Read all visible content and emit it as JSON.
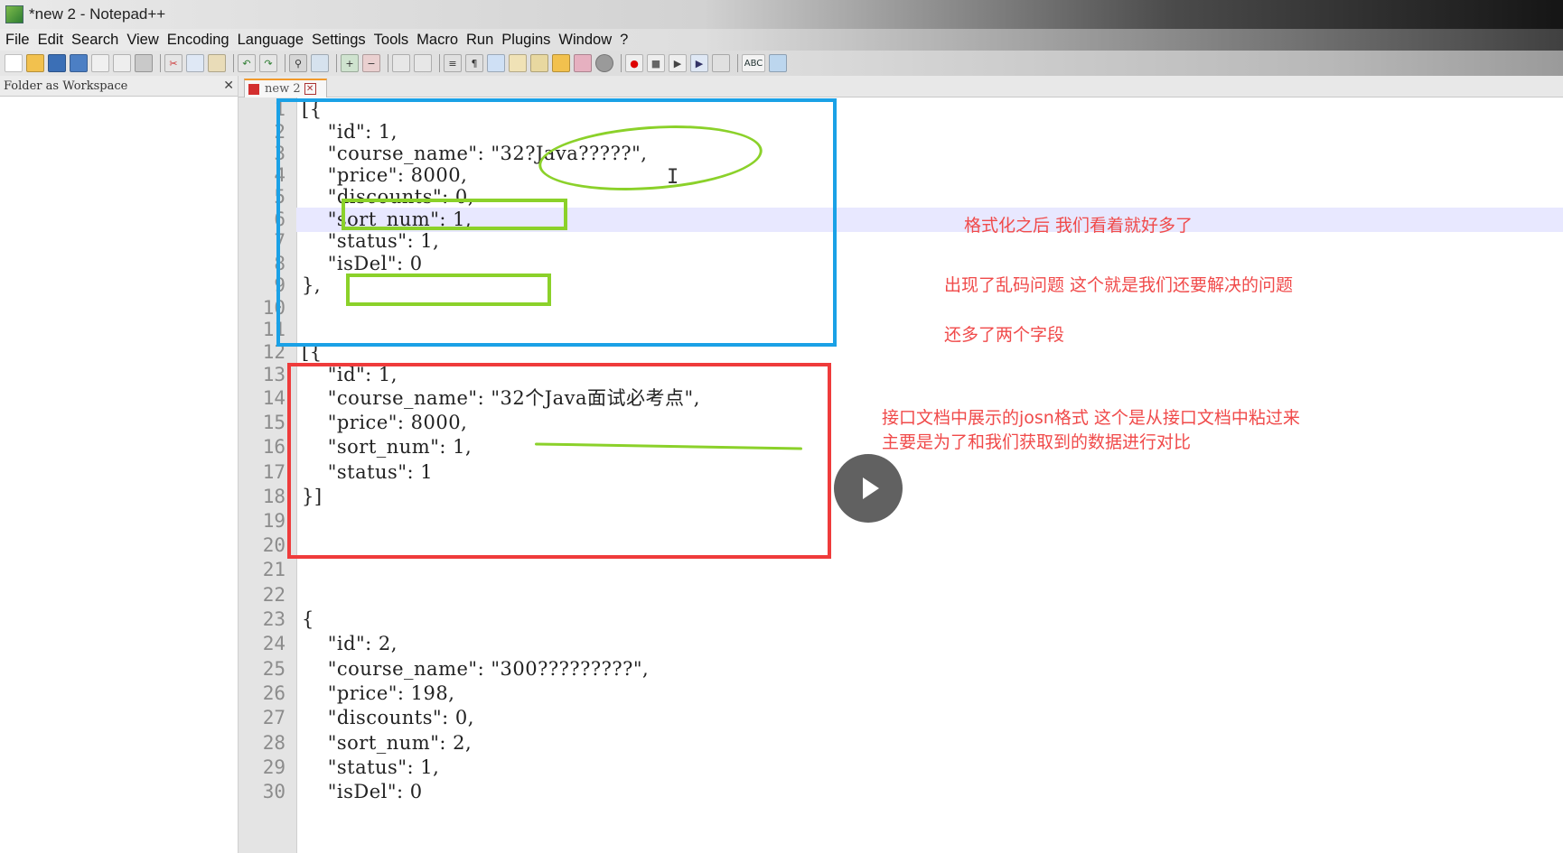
{
  "window": {
    "title": "*new 2 - Notepad++"
  },
  "menu": [
    "File",
    "Edit",
    "Search",
    "View",
    "Encoding",
    "Language",
    "Settings",
    "Tools",
    "Macro",
    "Run",
    "Plugins",
    "Window",
    "?"
  ],
  "toolbar": {
    "icons": [
      "new-file-icon",
      "open-file-icon",
      "save-icon",
      "save-all-icon",
      "close-icon",
      "close-all-icon",
      "print-icon",
      "cut-icon",
      "copy-icon",
      "paste-icon",
      "undo-icon",
      "redo-icon",
      "find-icon",
      "replace-icon",
      "zoom-in-icon",
      "zoom-out-icon",
      "sync-vertical-icon",
      "sync-horizontal-icon",
      "word-wrap-icon",
      "show-all-chars-icon",
      "indent-guide-icon",
      "doc-map-icon",
      "function-list-icon",
      "folder-workspace-icon",
      "monitor-icon",
      "macro-record-icon",
      "macro-stop-icon",
      "macro-play-icon",
      "macro-run-multiple-icon",
      "macro-save-icon",
      "spellcheck-icon",
      "plugin-icon"
    ],
    "spellcheck_label": "ABC"
  },
  "left_panel": {
    "title": "Folder as Workspace",
    "close": "✕"
  },
  "tab": {
    "label": "new 2",
    "close": "✕"
  },
  "editor": {
    "lines": [
      {
        "n": "1",
        "text": "[{"
      },
      {
        "n": "2",
        "text": "    \"id\": 1,"
      },
      {
        "n": "3",
        "text": "    \"course_name\": \"32?Java?????\","
      },
      {
        "n": "4",
        "text": "    \"price\": 8000,"
      },
      {
        "n": "5",
        "text": "    \"discounts\": 0,"
      },
      {
        "n": "6",
        "text": "    \"sort_num\": 1,"
      },
      {
        "n": "7",
        "text": "    \"status\": 1,"
      },
      {
        "n": "8",
        "text": "    \"isDel\": 0"
      },
      {
        "n": "9",
        "text": "},"
      },
      {
        "n": "10",
        "text": ""
      },
      {
        "n": "11",
        "text": ""
      },
      {
        "n": "12",
        "text": "[{"
      },
      {
        "n": "13",
        "text": "    \"id\": 1,"
      },
      {
        "n": "14",
        "text": "    \"course_name\": \"32个Java面试必考点\","
      },
      {
        "n": "15",
        "text": "    \"price\": 8000,"
      },
      {
        "n": "16",
        "text": "    \"sort_num\": 1,"
      },
      {
        "n": "17",
        "text": "    \"status\": 1"
      },
      {
        "n": "18",
        "text": "}]"
      },
      {
        "n": "19",
        "text": ""
      },
      {
        "n": "20",
        "text": ""
      },
      {
        "n": "21",
        "text": ""
      },
      {
        "n": "22",
        "text": ""
      },
      {
        "n": "23",
        "text": "{"
      },
      {
        "n": "24",
        "text": "    \"id\": 2,"
      },
      {
        "n": "25",
        "text": "    \"course_name\": \"300?????????\","
      },
      {
        "n": "26",
        "text": "    \"price\": 198,"
      },
      {
        "n": "27",
        "text": "    \"discounts\": 0,"
      },
      {
        "n": "28",
        "text": "    \"sort_num\": 2,"
      },
      {
        "n": "29",
        "text": "    \"status\": 1,"
      },
      {
        "n": "30",
        "text": "    \"isDel\": 0"
      }
    ]
  },
  "notes": {
    "n1": "格式化之后  我们看着就好多了",
    "n2": "出现了乱码问题 这个就是我们还要解决的问题",
    "n3": "还多了两个字段",
    "n4": "接口文档中展示的josn格式  这个是从接口文档中粘过来",
    "n5": "主要是为了和我们获取到的数据进行对比"
  },
  "colors": {
    "blue_box": "#1aa1e6",
    "red_box": "#ef3b3b",
    "green_mark": "#8bd12a",
    "note_text": "#f04a4a"
  }
}
